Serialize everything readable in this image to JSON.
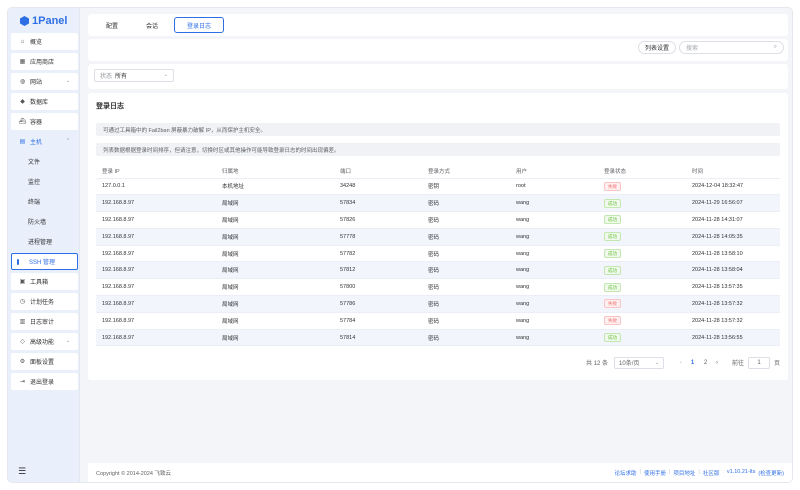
{
  "app": {
    "name": "1Panel"
  },
  "sidebar": {
    "items": [
      {
        "label": "概览",
        "icon": "home-icon",
        "ic": "⌂"
      },
      {
        "label": "应用商店",
        "icon": "grid-icon",
        "ic": "▦"
      },
      {
        "label": "网站",
        "icon": "globe-icon",
        "ic": "◍",
        "chevron": "⌄"
      },
      {
        "label": "数据库",
        "icon": "database-icon",
        "ic": "◆"
      },
      {
        "label": "容器",
        "icon": "container-icon",
        "ic": "⛴"
      },
      {
        "label": "主机",
        "icon": "host-icon",
        "ic": "▤",
        "chevron": "⌃"
      }
    ],
    "host_sub": [
      "文件",
      "监控",
      "终端",
      "防火墙",
      "进程管理",
      "SSH 管理"
    ],
    "items_after": [
      {
        "label": "工具箱",
        "icon": "toolbox-icon",
        "ic": "▣"
      },
      {
        "label": "计划任务",
        "icon": "clock-icon",
        "ic": "◷"
      },
      {
        "label": "日志审计",
        "icon": "log-icon",
        "ic": "▥"
      },
      {
        "label": "高级功能",
        "icon": "diamond-icon",
        "ic": "◇",
        "chevron": "⌄"
      },
      {
        "label": "面板设置",
        "icon": "settings-icon",
        "ic": "⚙"
      },
      {
        "label": "退出登录",
        "icon": "logout-icon",
        "ic": "⇥"
      }
    ],
    "collapse_glyph": "☰"
  },
  "tabs": [
    "配置",
    "会话",
    "登录日志"
  ],
  "toolbar": {
    "settings_label": "列表设置",
    "search_placeholder": "搜索",
    "search_icon": "⌕"
  },
  "filter": {
    "label": "状态",
    "value": "所有",
    "chevron": "⌄"
  },
  "log": {
    "title": "登录日志",
    "info1": "可通过工具箱中的 Fail2ban 屏蔽暴力破解 IP，从而保护主机安全。",
    "info2": "列表数据根据登录时间排序，但请注意，切换时区或其他操作可能导致登录日志的时间出现偏差。",
    "columns": [
      "登录 IP",
      "归属地",
      "端口",
      "登录方式",
      "用户",
      "登录状态",
      "时间"
    ],
    "rows": [
      [
        "127.0.0.1",
        "本机地址",
        "34248",
        "密钥",
        "root",
        "失败",
        "2024-12-04 18:32:47"
      ],
      [
        "192.168.8.97",
        "局域网",
        "57834",
        "密码",
        "wang",
        "成功",
        "2024-11-29 16:56:07"
      ],
      [
        "192.168.8.97",
        "局域网",
        "57826",
        "密码",
        "wang",
        "成功",
        "2024-11-28 14:31:07"
      ],
      [
        "192.168.8.97",
        "局域网",
        "57778",
        "密码",
        "wang",
        "成功",
        "2024-11-28 14:05:35"
      ],
      [
        "192.168.8.97",
        "局域网",
        "57782",
        "密码",
        "wang",
        "成功",
        "2024-11-28 13:58:10"
      ],
      [
        "192.168.8.97",
        "局域网",
        "57812",
        "密码",
        "wang",
        "成功",
        "2024-11-28 13:58:04"
      ],
      [
        "192.168.8.97",
        "局域网",
        "57800",
        "密码",
        "wang",
        "成功",
        "2024-11-28 13:57:35"
      ],
      [
        "192.168.8.97",
        "局域网",
        "57786",
        "密码",
        "wang",
        "失败",
        "2024-11-28 13:57:32"
      ],
      [
        "192.168.8.97",
        "局域网",
        "57784",
        "密码",
        "wang",
        "失败",
        "2024-11-28 13:57:32"
      ],
      [
        "192.168.8.97",
        "局域网",
        "57814",
        "密码",
        "wang",
        "成功",
        "2024-11-28 13:56:55"
      ]
    ],
    "fail_text": "失败"
  },
  "pager": {
    "total": "共 12 条",
    "size": "10条/页",
    "prev": "‹",
    "pages": [
      "1",
      "2"
    ],
    "next": "›",
    "goto": "前往",
    "goto_value": "1",
    "page_suffix": "页"
  },
  "footer": {
    "copyright": "Copyright © 2014-2024 飞致云",
    "links": [
      "论坛求助",
      "使用手册",
      "项目地址"
    ],
    "community": "社区版",
    "version": "v1.10.21-lts",
    "update": "(检查更新)"
  },
  "colors": {
    "accent": "#2f6fe6",
    "success": "#67c23a",
    "danger": "#f56c6c"
  }
}
